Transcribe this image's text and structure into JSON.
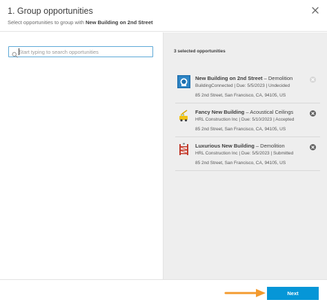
{
  "header": {
    "title": "1. Group opportunities",
    "subtitle_prefix": "Select opportunities to group with ",
    "subtitle_project": "New Building on 2nd Street"
  },
  "search": {
    "placeholder": "Start typing to search opportunities",
    "value": ""
  },
  "selection": {
    "count_label": "3 selected opportunities",
    "items": [
      {
        "title_bold": "New Building on 2nd Street",
        "title_rest": " – Demolition",
        "meta": "BuildingConnected | Due: 5/5/2023 | Undecided",
        "address": "85 2nd Street, San Francisco, CA, 94105, US",
        "logo": "building-logo-icon",
        "remove_enabled": false
      },
      {
        "title_bold": "Fancy New Building",
        "title_rest": " – Acoustical Ceilings",
        "meta": "HRL Construction Inc | Due: 5/10/2023 | Accepted",
        "address": "85 2nd Street, San Francisco, CA, 94105, US",
        "logo": "crane-logo-icon",
        "remove_enabled": true
      },
      {
        "title_bold": "Luxurious New Building",
        "title_rest": " – Demolition",
        "meta": "HRL Construction Inc | Due: 5/5/2023 | Submitted",
        "address": "85 2nd Street, San Francisco, CA, 94105, US",
        "logo": "scaffold-logo-icon",
        "remove_enabled": true
      }
    ]
  },
  "footer": {
    "next_label": "Next"
  },
  "colors": {
    "accent": "#0696d7",
    "arrow": "#f39a2e",
    "right_pane_bg": "#eeeeee",
    "search_border": "#5aa7d6"
  }
}
